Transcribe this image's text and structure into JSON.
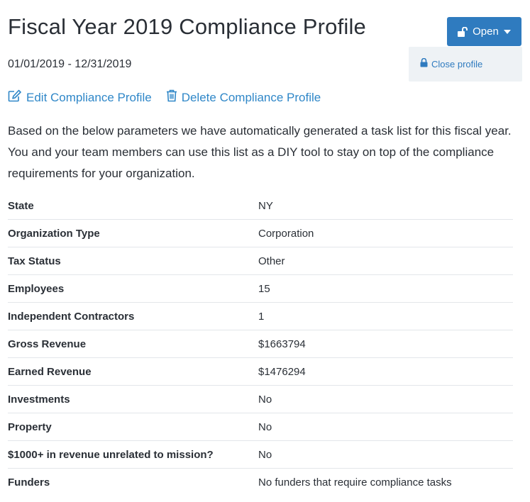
{
  "profile": {
    "title": "Fiscal Year 2019 Compliance Profile",
    "date_range": "01/01/2019 - 12/31/2019"
  },
  "status_button": {
    "label": "Open",
    "lock_icon": "unlock-icon",
    "caret_icon": "caret-down-icon"
  },
  "status_menu": {
    "items": [
      {
        "label": "Close profile",
        "icon": "lock-icon"
      }
    ]
  },
  "actions": {
    "edit_label": "Edit Compliance Profile",
    "delete_label": "Delete Compliance Profile"
  },
  "intro_text": "Based on the below parameters we have automatically generated a task list for this fiscal year. You and your team members can use this list as a DIY tool to stay on top of the compliance requirements for your organization.",
  "parameters": [
    {
      "label": "State",
      "value": "NY"
    },
    {
      "label": "Organization Type",
      "value": "Corporation"
    },
    {
      "label": "Tax Status",
      "value": "Other"
    },
    {
      "label": "Employees",
      "value": "15"
    },
    {
      "label": "Independent Contractors",
      "value": "1"
    },
    {
      "label": "Gross Revenue",
      "value": "$1663794"
    },
    {
      "label": "Earned Revenue",
      "value": "$1476294"
    },
    {
      "label": "Investments",
      "value": "No"
    },
    {
      "label": "Property",
      "value": "No"
    },
    {
      "label": "$1000+ in revenue unrelated to mission?",
      "value": "No"
    },
    {
      "label": "Funders",
      "value": "No funders that require compliance tasks"
    }
  ],
  "colors": {
    "accent": "#2f7bbf",
    "link": "#2f87c8",
    "text": "#2a2f36",
    "menu_bg": "#eef2f5",
    "divider": "#e3e6ea"
  }
}
